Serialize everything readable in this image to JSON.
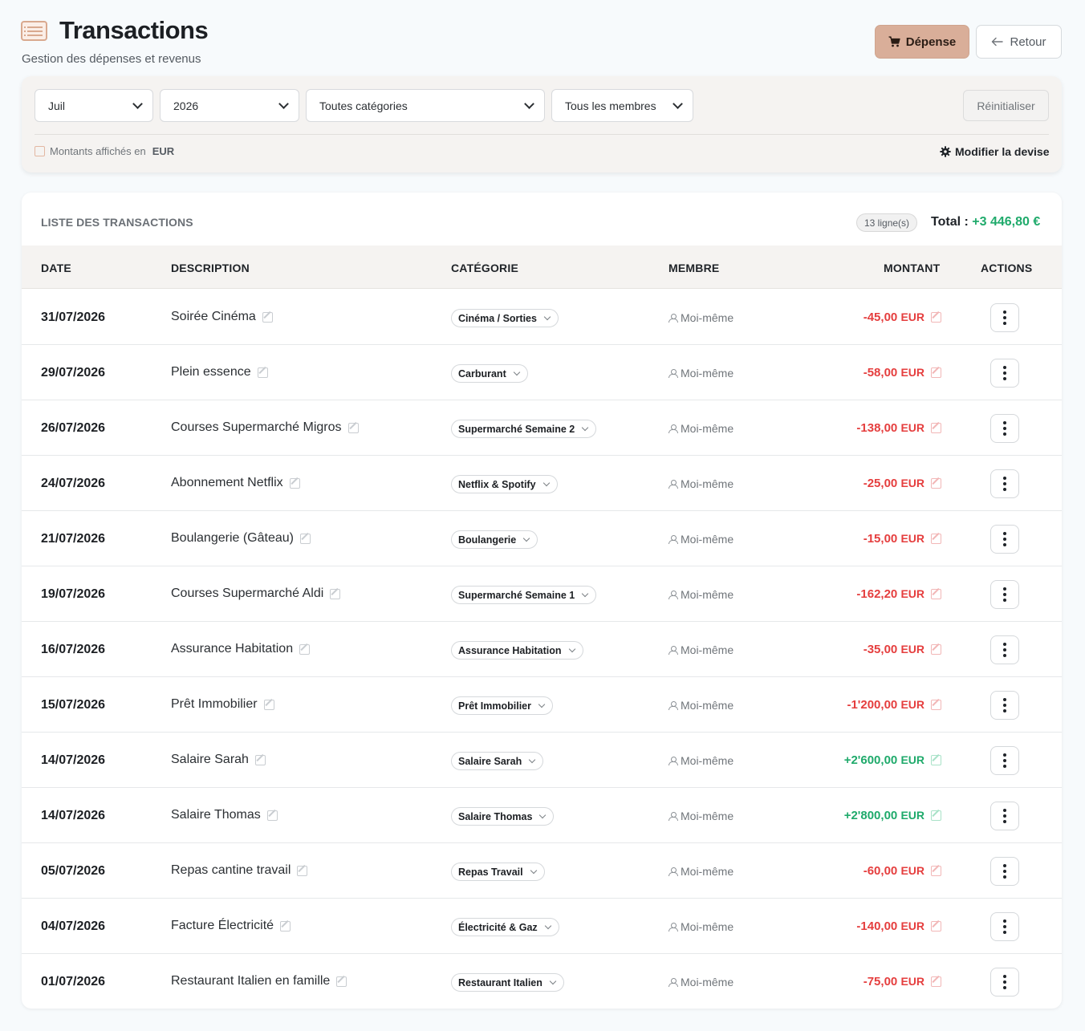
{
  "header": {
    "title": "Transactions",
    "subtitle": "Gestion des dépenses et revenus",
    "expense_button": "Dépense",
    "back_button": "Retour"
  },
  "filters": {
    "month": "Juil",
    "year": "2026",
    "category": "Toutes catégories",
    "member": "Tous les membres",
    "reset_button": "Réinitialiser",
    "currency_label": "Montants affichés en",
    "currency_code": "EUR",
    "change_currency": "Modifier la devise"
  },
  "list": {
    "title": "LISTE DES TRANSACTIONS",
    "row_count": "13 ligne(s)",
    "total_label": "Total :",
    "total_value": "+3 446,80 €",
    "columns": {
      "date": "DATE",
      "description": "DESCRIPTION",
      "category": "CATÉGORIE",
      "member": "MEMBRE",
      "amount": "MONTANT",
      "actions": "ACTIONS"
    },
    "rows": [
      {
        "date": "31/07/2026",
        "description": "Soirée Cinéma",
        "category": "Cinéma / Sorties",
        "member": "Moi-même",
        "amount": "-45,00",
        "currency": "EUR",
        "type": "neg"
      },
      {
        "date": "29/07/2026",
        "description": "Plein essence",
        "category": "Carburant",
        "member": "Moi-même",
        "amount": "-58,00",
        "currency": "EUR",
        "type": "neg"
      },
      {
        "date": "26/07/2026",
        "description": "Courses Supermarché Migros",
        "category": "Supermarché Semaine 2",
        "member": "Moi-même",
        "amount": "-138,00",
        "currency": "EUR",
        "type": "neg"
      },
      {
        "date": "24/07/2026",
        "description": "Abonnement Netflix",
        "category": "Netflix & Spotify",
        "member": "Moi-même",
        "amount": "-25,00",
        "currency": "EUR",
        "type": "neg"
      },
      {
        "date": "21/07/2026",
        "description": "Boulangerie (Gâteau)",
        "category": "Boulangerie",
        "member": "Moi-même",
        "amount": "-15,00",
        "currency": "EUR",
        "type": "neg"
      },
      {
        "date": "19/07/2026",
        "description": "Courses Supermarché Aldi",
        "category": "Supermarché Semaine 1",
        "member": "Moi-même",
        "amount": "-162,20",
        "currency": "EUR",
        "type": "neg"
      },
      {
        "date": "16/07/2026",
        "description": "Assurance Habitation",
        "category": "Assurance Habitation",
        "member": "Moi-même",
        "amount": "-35,00",
        "currency": "EUR",
        "type": "neg"
      },
      {
        "date": "15/07/2026",
        "description": "Prêt Immobilier",
        "category": "Prêt Immobilier",
        "member": "Moi-même",
        "amount": "-1'200,00",
        "currency": "EUR",
        "type": "neg"
      },
      {
        "date": "14/07/2026",
        "description": "Salaire Sarah",
        "category": "Salaire Sarah",
        "member": "Moi-même",
        "amount": "+2'600,00",
        "currency": "EUR",
        "type": "pos"
      },
      {
        "date": "14/07/2026",
        "description": "Salaire Thomas",
        "category": "Salaire Thomas",
        "member": "Moi-même",
        "amount": "+2'800,00",
        "currency": "EUR",
        "type": "pos"
      },
      {
        "date": "05/07/2026",
        "description": "Repas cantine travail",
        "category": "Repas Travail",
        "member": "Moi-même",
        "amount": "-60,00",
        "currency": "EUR",
        "type": "neg"
      },
      {
        "date": "04/07/2026",
        "description": "Facture Électricité",
        "category": "Électricité & Gaz",
        "member": "Moi-même",
        "amount": "-140,00",
        "currency": "EUR",
        "type": "neg"
      },
      {
        "date": "01/07/2026",
        "description": "Restaurant Italien en famille",
        "category": "Restaurant Italien",
        "member": "Moi-même",
        "amount": "-75,00",
        "currency": "EUR",
        "type": "neg"
      }
    ]
  },
  "colors": {
    "accent": "#d9ae99",
    "negative": "#e53e3e",
    "positive": "#1faa6b"
  },
  "icons": {
    "title": "list-icon",
    "expense": "cart-icon",
    "back": "arrow-left-icon",
    "currency": "currency-icon",
    "settings": "gear-icon",
    "edit": "edit-icon",
    "member": "user-icon",
    "actions": "kebab-menu-icon"
  }
}
